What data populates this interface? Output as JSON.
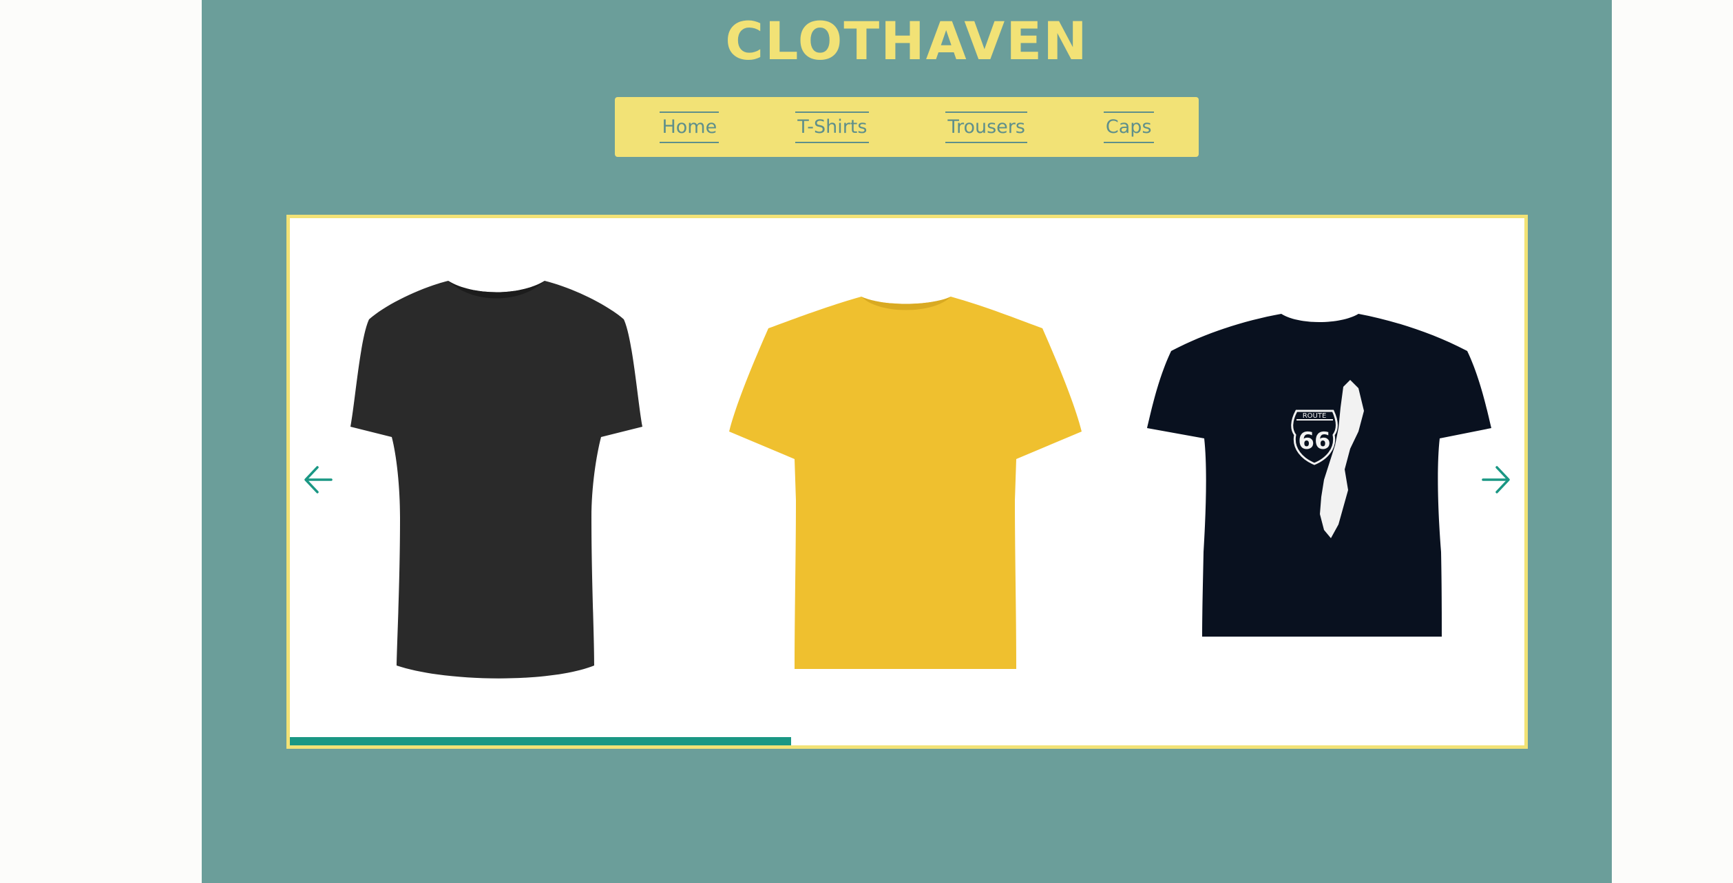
{
  "header": {
    "brand": "CLOTHAVEN"
  },
  "nav": {
    "items": [
      {
        "label": "Home",
        "name": "nav-home"
      },
      {
        "label": "T-Shirts",
        "name": "nav-tshirts"
      },
      {
        "label": "Trousers",
        "name": "nav-trousers"
      },
      {
        "label": "Caps",
        "name": "nav-caps"
      }
    ]
  },
  "carousel": {
    "prev_icon": "arrow-left-icon",
    "next_icon": "arrow-right-icon",
    "progress": 0.406,
    "slides": [
      {
        "image": "black-tshirt",
        "color": "#2a2a2a"
      },
      {
        "image": "yellow-tshirt",
        "color": "#efc02f"
      },
      {
        "image": "navy-route66-tshirt",
        "color": "#09111f",
        "print_text_small": "ROUTE",
        "print_text_big": "66"
      }
    ]
  },
  "colors": {
    "page_bg": "#6b9e9a",
    "accent": "#f2e276",
    "nav_text": "#5e8f8b",
    "progress": "#1a9784"
  }
}
